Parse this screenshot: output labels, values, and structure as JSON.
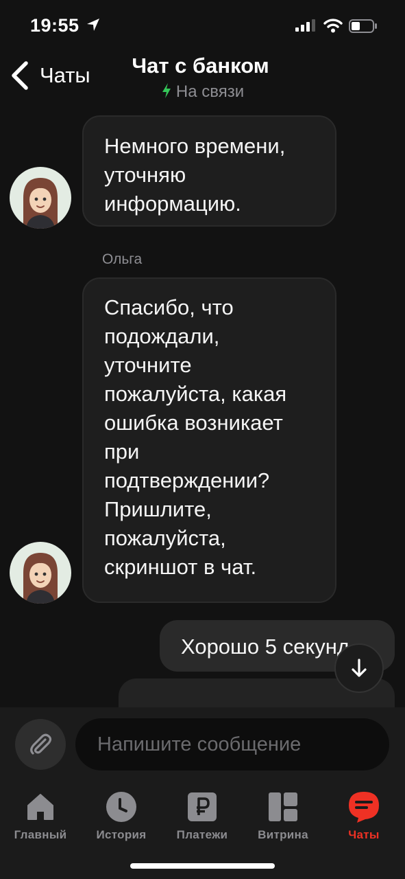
{
  "status_bar": {
    "time": "19:55"
  },
  "header": {
    "back_label": "Чаты",
    "title": "Чат с банком",
    "subtitle": "На связи"
  },
  "messages": [
    {
      "direction": "incoming",
      "text": "Немного времени,\nуточняю\nинформацию."
    },
    {
      "direction": "incoming",
      "sender": "Ольга",
      "text": "Спасибо, что\nподождали,\nуточните\nпожалуйста, какая\nошибка возникает\nпри\nподтверждении?\nПришлите,\nпожалуйста,\nскриншот в чат."
    },
    {
      "direction": "outgoing",
      "text": "Хорошо 5 секунд"
    }
  ],
  "composer": {
    "placeholder": "Напишите сообщение"
  },
  "tabs": [
    {
      "label": "Главный",
      "icon": "home-icon",
      "active": false
    },
    {
      "label": "История",
      "icon": "clock-icon",
      "active": false
    },
    {
      "label": "Платежи",
      "icon": "ruble-icon",
      "active": false
    },
    {
      "label": "Витрина",
      "icon": "grid-icon",
      "active": false
    },
    {
      "label": "Чаты",
      "icon": "chat-icon",
      "active": true
    }
  ],
  "colors": {
    "accent": "#EF3124",
    "online": "#34C759",
    "background": "#121212"
  }
}
